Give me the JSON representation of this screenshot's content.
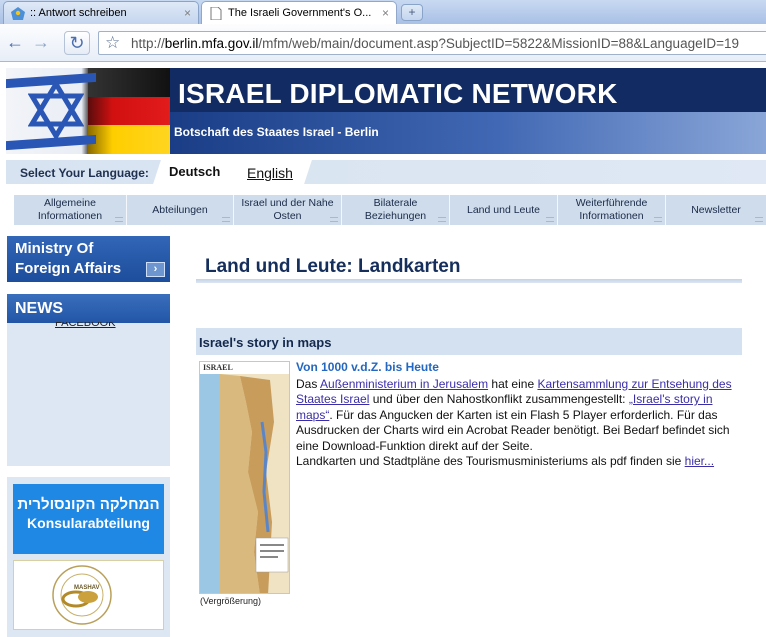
{
  "browser": {
    "tabs": [
      {
        "title": ":: Antwort schreiben",
        "active": false
      },
      {
        "title": "The Israeli Government's O...",
        "active": true
      }
    ],
    "close_glyph": "×",
    "new_tab_glyph": "+",
    "back_glyph": "←",
    "forward_glyph": "→",
    "reload_glyph": "↻",
    "star_glyph": "☆",
    "url_prefix": "http://",
    "url_domain": "berlin.mfa.gov.il",
    "url_path": "/mfm/web/main/document.asp?SubjectID=5822&MissionID=88&LanguageID=19"
  },
  "banner": {
    "title": "ISRAEL DIPLOMATIC NETWORK",
    "subtitle": "Botschaft des Staates Israel - Berlin"
  },
  "language": {
    "label": "Select Your Language:",
    "current": "Deutsch",
    "other": "English"
  },
  "menu": {
    "items": [
      {
        "label": "Allgemeine Informationen"
      },
      {
        "label": "Abteilungen"
      },
      {
        "label": "Israel und der Nahe Osten"
      },
      {
        "label": "Bilaterale Beziehungen"
      },
      {
        "label": "Land und Leute"
      },
      {
        "label": "Weiterführende Informationen"
      },
      {
        "label": "Newsletter"
      }
    ]
  },
  "sidebar": {
    "mofa_line1": "Ministry Of",
    "mofa_line2": "Foreign Affairs",
    "mofa_arrow": "›",
    "news_title": "NEWS",
    "news_link": "FACEBOOK",
    "konsular_he": "המחלקה הקונסולרית",
    "konsular_de": "Konsularabteilung",
    "mashav_text": "MASHAV"
  },
  "main": {
    "page_title": "Land und Leute: Landkarten",
    "section_title": "Israel's story in maps",
    "map_caption": "(Vergrößerung)",
    "map_label": "ISRAEL",
    "article_title": "Von 1000 v.d.Z. bis Heute",
    "p1_t1": "Das ",
    "p1_link1": "Außenministerium in Jerusalem",
    "p1_t2": " hat eine ",
    "p1_link2": "Kartensammlung zur Entsehung des Staates Israel",
    "p1_t3": " und über den Nahostkonflikt zusammengestellt: ",
    "p1_link3": "„Israel's story in maps“",
    "p1_t4": ". Für das Angucken der Karten ist ein Flash 5 Player erforderlich. Für das Ausdrucken der Charts wird ein Acrobat Reader benötigt. Bei Bedarf befindet sich eine Download-Funktion direkt auf der Seite.",
    "p2_t1": "Landkarten und Stadtpläne des Tourismusministeriums als pdf finden sie ",
    "p2_link": "hier..."
  }
}
